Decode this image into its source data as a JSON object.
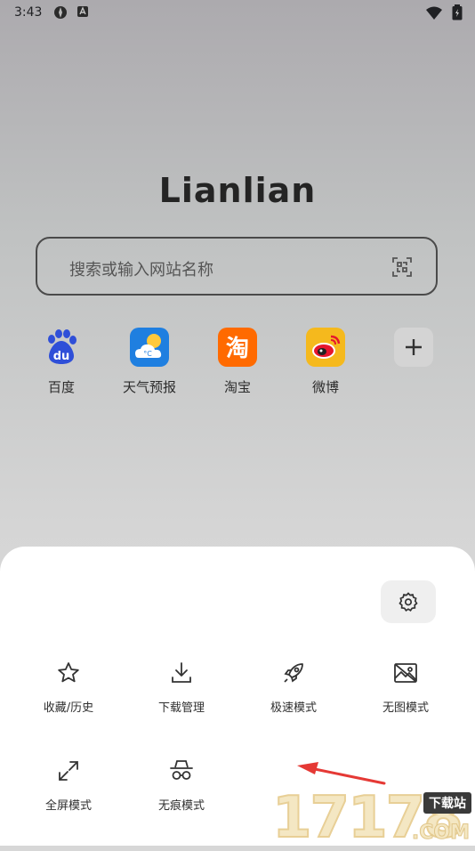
{
  "status_bar": {
    "time": "3:43",
    "icons": [
      "app-icon-1",
      "app-icon-2",
      "wifi-icon",
      "battery-icon"
    ]
  },
  "home": {
    "logo_text": "Lianlian",
    "search": {
      "placeholder": "搜索或输入网站名称",
      "scan_icon": "scan-icon"
    },
    "shortcuts": [
      {
        "label": "百度",
        "icon": "baidu-icon"
      },
      {
        "label": "天气预报",
        "icon": "weather-icon"
      },
      {
        "label": "淘宝",
        "icon": "taobao-icon"
      },
      {
        "label": "微博",
        "icon": "weibo-icon"
      }
    ],
    "add_icon": "add-icon"
  },
  "menu": {
    "settings_icon": "gear-icon",
    "items": [
      {
        "label": "收藏/历史",
        "icon": "star-icon"
      },
      {
        "label": "下载管理",
        "icon": "download-icon"
      },
      {
        "label": "极速模式",
        "icon": "rocket-icon"
      },
      {
        "label": "无图模式",
        "icon": "no-image-icon"
      },
      {
        "label": "全屏模式",
        "icon": "fullscreen-icon"
      },
      {
        "label": "无痕模式",
        "icon": "incognito-icon"
      }
    ]
  },
  "watermark": {
    "digits": "17178",
    "badge": "下载站",
    "domain": ".COM"
  },
  "colors": {
    "annotation_arrow": "#e53935",
    "baidu_blue": "#2f4fd8",
    "weather_blue": "#1f7fe0",
    "taobao_orange": "#ff6a00",
    "weibo_yellow": "#f5b91d"
  }
}
